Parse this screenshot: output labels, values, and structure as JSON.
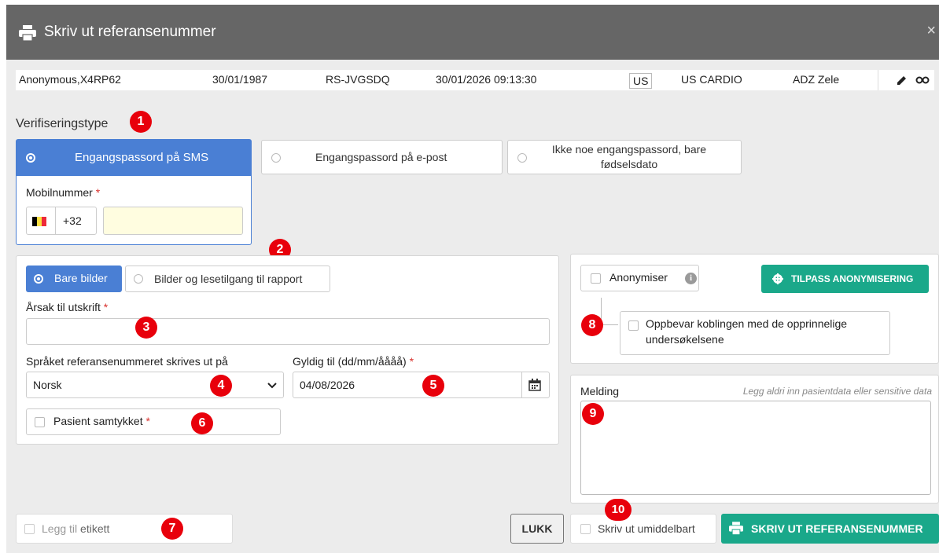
{
  "dialog": {
    "title": "Skriv ut referansenummer",
    "close_label": "×"
  },
  "study": {
    "patient": "Anonymous,X4RP62",
    "birth_date": "30/01/1987",
    "reference": "RS-JVGSDQ",
    "study_datetime": "30/01/2026 09:13:30",
    "modality": "US",
    "description": "US CARDIO",
    "site": "ADZ Zele"
  },
  "verification": {
    "label": "Verifiseringstype",
    "options": [
      "Engangspassord på SMS",
      "Engangspassord på e-post",
      "Ikke noe engangspassord, bare fødselsdato"
    ],
    "selected_index": 0,
    "mobile_label": "Mobilnummer",
    "required_mark": "*",
    "country_code": "+32",
    "mobile_value": ""
  },
  "access": {
    "options": [
      "Bare bilder",
      "Bilder og lesetilgang til rapport"
    ],
    "selected_index": 0,
    "reason_label": "Årsak til utskrift",
    "reason_value": "",
    "language_label": "Språket referansenummeret skrives ut på",
    "language_value": "Norsk",
    "valid_label": "Gyldig til (dd/mm/åååå)",
    "valid_value": "04/08/2026",
    "consent_label": "Pasient samtykket"
  },
  "anonymize": {
    "label": "Anonymiser",
    "customize_button": "TILPASS ANONYMISERING",
    "keep_link_label": "Oppbevar koblingen med de opprinnelige undersøkelsene"
  },
  "message": {
    "label": "Melding",
    "hint": "Legg aldri inn pasientdata eller sensitive data",
    "value": ""
  },
  "footer": {
    "add_label_prefix": "Legg til",
    "add_label_suffix": "etikett",
    "close_button": "LUKK",
    "print_now_label": "Skriv ut umiddelbart",
    "print_button": "SKRIV UT REFERANSENUMMER"
  },
  "badges": [
    "1",
    "2",
    "3",
    "4",
    "5",
    "6",
    "7",
    "8",
    "9",
    "10"
  ],
  "colors": {
    "titlebar": "#666666",
    "selected_blue": "#4a7fd4",
    "teal_button": "#1aa88a",
    "badge_red": "#e8000b",
    "required_red": "#d9322e",
    "mobile_field_yellow": "#fffde0"
  }
}
